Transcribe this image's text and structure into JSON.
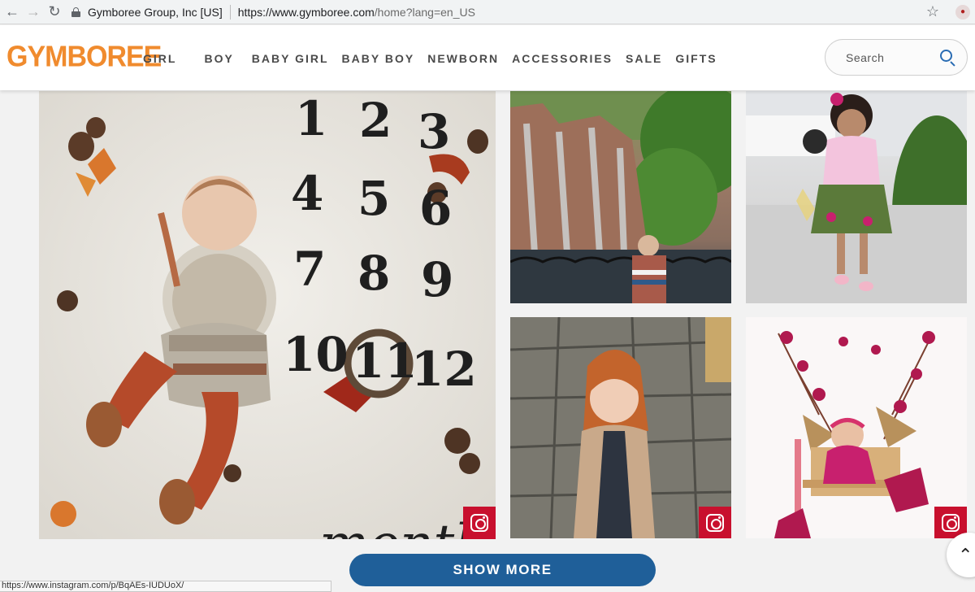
{
  "browser": {
    "site_identity": "Gymboree Group, Inc [US]",
    "url_host": "https://www.gymboree.com",
    "url_path": "/home?lang=en_US",
    "status_url": "https://www.instagram.com/p/BqAEs-IUDUoX/"
  },
  "header": {
    "logo": "GYMBOREE",
    "nav": [
      "GIRL",
      "BOY",
      "BABY GIRL",
      "BABY BOY",
      "NEWBORN",
      "ACCESSORIES",
      "SALE",
      "GIFTS"
    ],
    "search_placeholder": "Search"
  },
  "gallery": {
    "main_photo": {
      "numbers": [
        "1",
        "2",
        "3",
        "4",
        "5",
        "6",
        "7",
        "8",
        "9",
        "10",
        "11",
        "12"
      ],
      "script_word": "months"
    },
    "tiles": [
      "instagram-photo",
      "instagram-photo",
      "instagram-photo",
      "instagram-photo",
      "instagram-photo"
    ]
  },
  "actions": {
    "show_more": "SHOW MORE"
  },
  "colors": {
    "brand_orange": "#f08b2e",
    "button_blue": "#1f5f99",
    "instagram_red": "#c8102e"
  }
}
